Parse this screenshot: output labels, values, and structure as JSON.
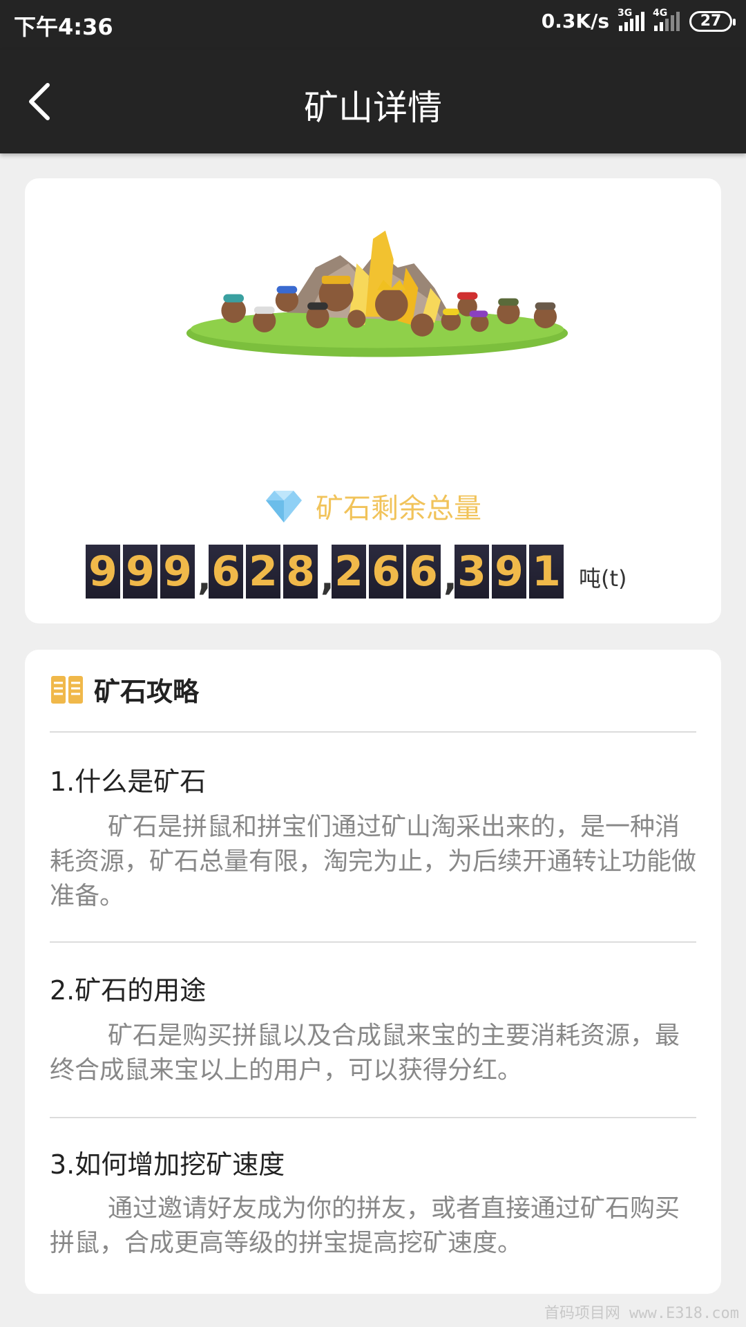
{
  "status_bar": {
    "time": "下午4:36",
    "net_speed": "0.3K/s",
    "signal1_label": "3G",
    "signal2_label": "4G",
    "battery": "27"
  },
  "nav": {
    "title": "矿山详情",
    "back_icon": "chevron-left-icon"
  },
  "mine": {
    "ore_label": "矿石剩余总量",
    "digits": [
      "9",
      "9",
      "9",
      ",",
      "6",
      "2",
      "8",
      ",",
      "2",
      "6",
      "6",
      ",",
      "3",
      "9",
      "1"
    ],
    "unit": "吨(t)",
    "accent_color": "#f1c35a"
  },
  "guide": {
    "title": "矿石攻略",
    "sections": [
      {
        "title": "1.什么是矿石",
        "body": "矿石是拼鼠和拼宝们通过矿山淘采出来的，是一种消耗资源，矿石总量有限，淘完为止，为后续开通转让功能做准备。"
      },
      {
        "title": "2.矿石的用途",
        "body": "矿石是购买拼鼠以及合成鼠来宝的主要消耗资源，最终合成鼠来宝以上的用户，可以获得分红。"
      },
      {
        "title": "3.如何增加挖矿速度",
        "body": "通过邀请好友成为你的拼友，或者直接通过矿石购买拼鼠，合成更高等级的拼宝提高挖矿速度。"
      }
    ]
  },
  "watermark": "首码项目网 www.E318.com"
}
